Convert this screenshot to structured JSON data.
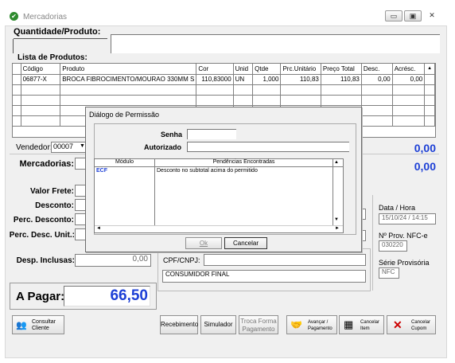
{
  "window": {
    "title": "Mercadorias",
    "btn_min": "▭",
    "btn_max": "▣",
    "btn_close": "✕"
  },
  "header": {
    "qty_product_label": "Quantidade/Produto:"
  },
  "list": {
    "label": "Lista de Produtos:",
    "columns": [
      "Código",
      "Produto",
      "Cor",
      "Unid",
      "Qtde",
      "Prc.Unitário",
      "Preço Total",
      "Desc.",
      "Acrésc."
    ],
    "rows": [
      [
        "06877-X",
        "BROCA FIBROCIMENTO/MOURAO 330MM S",
        "110,83000",
        "UN",
        "1,000",
        "110,83",
        "110,83",
        "0,00",
        "0,00"
      ]
    ]
  },
  "vendedor": {
    "label": "Vendedor:",
    "value": "00007",
    "total": "0,00"
  },
  "mercadorias": {
    "label": "Mercadorias:",
    "total": "0,00"
  },
  "fields": {
    "frete_label": "Valor Frete:",
    "desconto_label": "Desconto:",
    "perc_desc_label": "Perc. Desconto:",
    "perc_desc_unit_label": "Perc. Desc. Unit.:",
    "desp_label": "Desp. Inclusas:",
    "desp_value": "0,00"
  },
  "pagar": {
    "label": "A Pagar:",
    "value": "66,50"
  },
  "right": {
    "date_label": "Data / Hora",
    "date_value": "15/10/24 / 14:15",
    "prov_label": "Nº Prov. NFC-e",
    "prov_value": "030220",
    "serie_label": "Série Provisória",
    "serie_value": "NFC"
  },
  "customer": {
    "cpf_label": "CPF/CNPJ:",
    "cpf_value": "",
    "name": "CONSUMIDOR FINAL"
  },
  "dialog": {
    "title": "Diálogo de Permissão",
    "senha_label": "Senha",
    "autorizado_label": "Autorizado",
    "col_modulo": "Módulo",
    "col_pend": "Pendências Encontradas",
    "rows": [
      {
        "modulo": "ECF",
        "pend": "Desconto no subtotal acima do permitido"
      }
    ],
    "ok": "Ok",
    "cancel": "Cancelar"
  },
  "buttons": {
    "consultar_line1": "Consultar",
    "consultar_line2": "Cliente",
    "recebimento": "Recebimento",
    "simulador": "Simulador",
    "troca_line1": "Troca Forma",
    "troca_line2": "Pagamento",
    "avancar_line1": "Avançar /",
    "avancar_line2": "Pagamento",
    "cancelar_item_line1": "Cancelar",
    "cancelar_item_line2": "Item",
    "cancelar_cupom_line1": "Cancelar",
    "cancelar_cupom_line2": "Cupom"
  }
}
